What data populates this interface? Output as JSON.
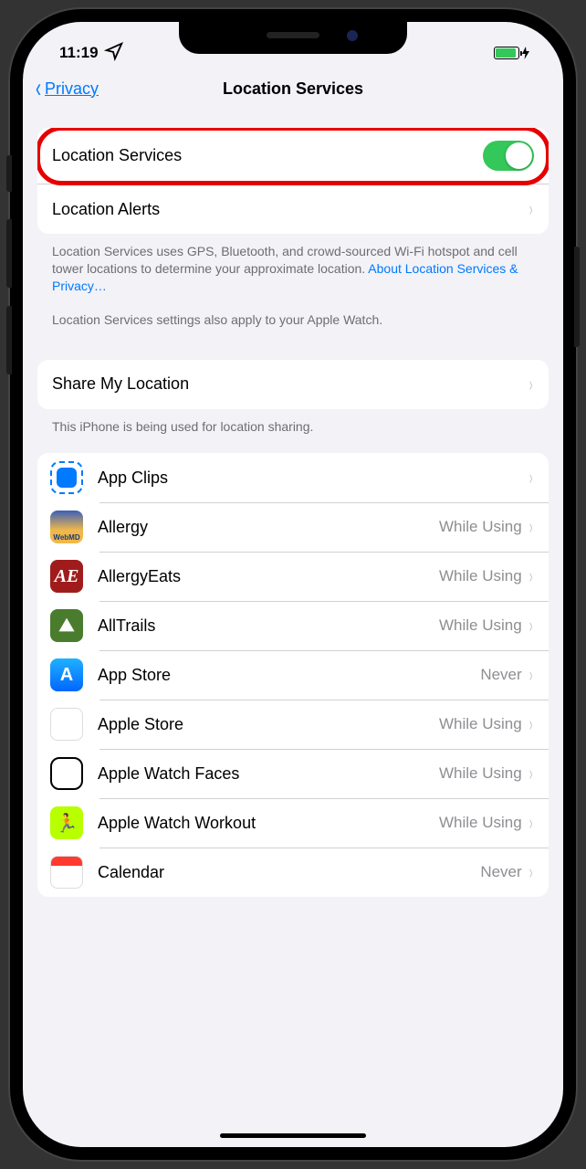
{
  "status": {
    "time": "11:19"
  },
  "nav": {
    "back": "Privacy",
    "title": "Location Services"
  },
  "main_toggle": {
    "label": "Location Services",
    "enabled": true
  },
  "location_alerts": "Location Alerts",
  "footer1_text": "Location Services uses GPS, Bluetooth, and crowd-sourced Wi-Fi hotspot and cell tower locations to determine your approximate location. ",
  "footer1_link": "About Location Services & Privacy…",
  "footer2": "Location Services settings also apply to your Apple Watch.",
  "share_row": "Share My Location",
  "share_footer": "This iPhone is being used for location sharing.",
  "apps": [
    {
      "name": "App Clips",
      "status": "",
      "icon": "appclips",
      "glyph": ""
    },
    {
      "name": "Allergy",
      "status": "While Using",
      "icon": "allergy",
      "glyph": "WebMD"
    },
    {
      "name": "AllergyEats",
      "status": "While Using",
      "icon": "allergyeats",
      "glyph": "AE"
    },
    {
      "name": "AllTrails",
      "status": "While Using",
      "icon": "alltrails",
      "glyph": "⛰"
    },
    {
      "name": "App Store",
      "status": "Never",
      "icon": "appstore",
      "glyph": "A"
    },
    {
      "name": "Apple Store",
      "status": "While Using",
      "icon": "applestore",
      "glyph": "🛍"
    },
    {
      "name": "Apple Watch Faces",
      "status": "While Using",
      "icon": "watch",
      "glyph": ""
    },
    {
      "name": "Apple Watch Workout",
      "status": "While Using",
      "icon": "workout",
      "glyph": "🏃"
    },
    {
      "name": "Calendar",
      "status": "Never",
      "icon": "calendar",
      "glyph": ""
    }
  ]
}
